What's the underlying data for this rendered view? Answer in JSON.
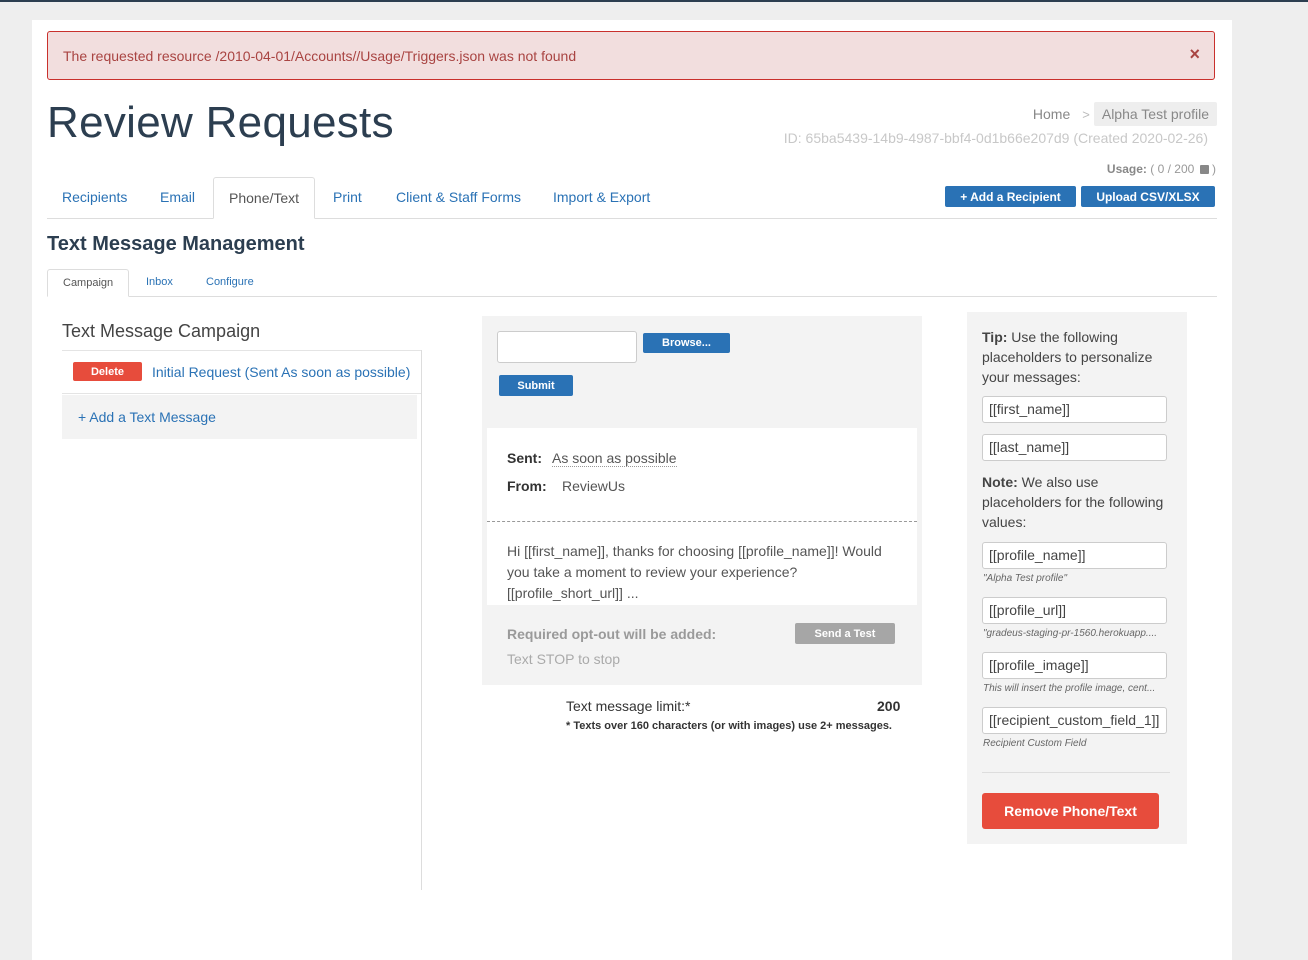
{
  "alert": {
    "message": "The requested resource /2010-04-01/Accounts//Usage/Triggers.json was not found",
    "close": "×"
  },
  "page_title": "Review Requests",
  "breadcrumb": {
    "home": "Home",
    "separator": ">",
    "current": "Alpha Test profile"
  },
  "id_line": "ID: 65ba5439-14b9-4987-bbf4-0d1b66e207d9 (Created 2020-02-26)",
  "usage": {
    "label": "Usage:",
    "open": "(",
    "value": "0 / 200",
    "close": ")"
  },
  "actions": {
    "add_recipient": "+ Add a Recipient",
    "upload": "Upload CSV/XLSX"
  },
  "tabs": [
    {
      "label": "Recipients"
    },
    {
      "label": "Email"
    },
    {
      "label": "Phone/Text"
    },
    {
      "label": "Print"
    },
    {
      "label": "Client & Staff Forms"
    },
    {
      "label": "Import & Export"
    }
  ],
  "section_title": "Text Message Management",
  "subtabs": [
    {
      "label": "Campaign"
    },
    {
      "label": "Inbox"
    },
    {
      "label": "Configure"
    }
  ],
  "campaign": {
    "title": "Text Message Campaign",
    "delete_label": "Delete",
    "message_link": "Initial Request (Sent As soon as possible)",
    "add_message": "+ Add a Text Message"
  },
  "upload": {
    "browse": "Browse...",
    "submit": "Submit"
  },
  "message": {
    "sent_label": "Sent:",
    "sent_value": "As soon as possible",
    "from_label": "From:",
    "from_value": "ReviewUs",
    "body": "Hi [[first_name]], thanks for choosing [[profile_name]]! Would you take a moment to review your experience? [[profile_short_url]] ...",
    "optout_label": "Required opt-out will be added:",
    "optout_text": "Text STOP to stop",
    "send_test": "Send a Test"
  },
  "limit": {
    "label": "Text message limit:*",
    "value": "200",
    "note": "* Texts over 160 characters (or with images) use 2+ messages."
  },
  "tips": {
    "tip_bold": "Tip:",
    "tip_text": " Use the following placeholders to personalize your messages:",
    "first_name": "[[first_name]]",
    "last_name": "[[last_name]]",
    "note_bold": "Note:",
    "note_text": " We also use placeholders for the following values:",
    "profile_name": "[[profile_name]]",
    "profile_name_cap": "\"Alpha Test profile\"",
    "profile_url": "[[profile_url]]",
    "profile_url_cap": "\"gradeus-staging-pr-1560.herokuapp....",
    "profile_image": "[[profile_image]]",
    "profile_image_cap": "This will insert the profile image, cent...",
    "custom_field": "[[recipient_custom_field_1]]",
    "custom_field_cap": "Recipient Custom Field",
    "remove_button": "Remove Phone/Text"
  },
  "colors": {
    "primary": "#2a72b5",
    "danger": "#e74c3c",
    "alert_bg": "#f2dede",
    "alert_text": "#a94442",
    "heading": "#2c3e50"
  }
}
